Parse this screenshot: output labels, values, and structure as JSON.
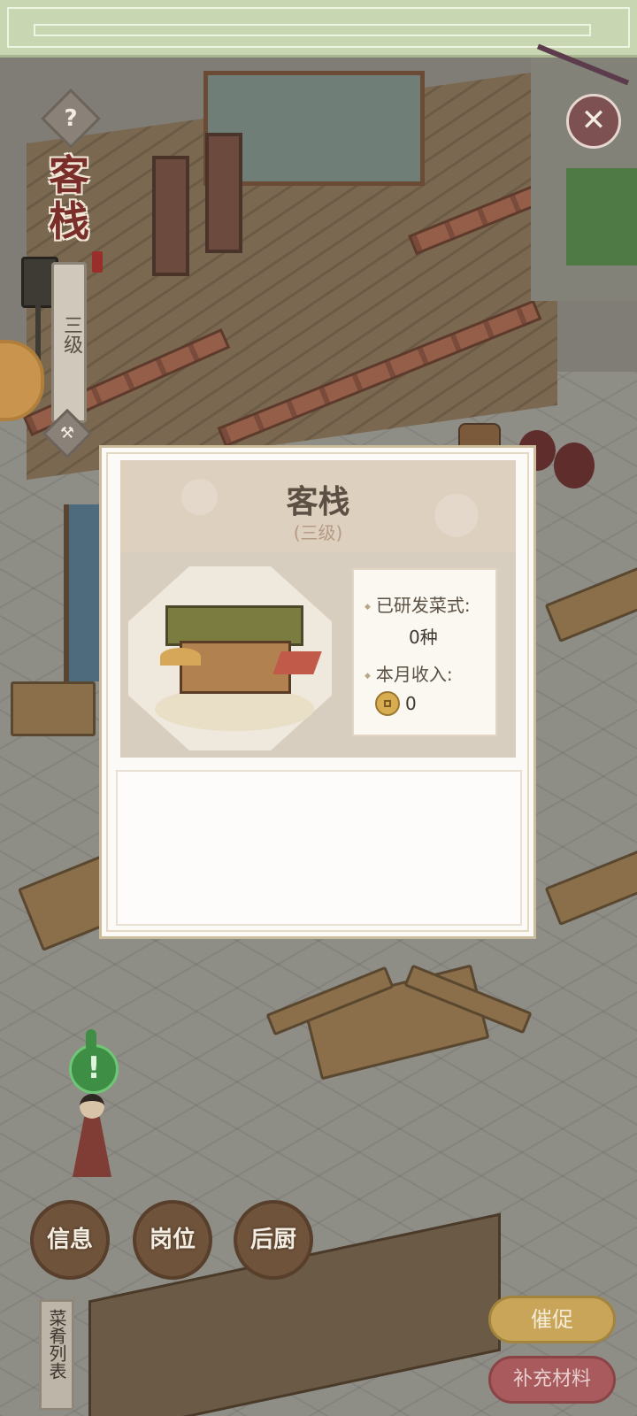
{
  "header": {
    "building_name": "客栈",
    "level": "三级"
  },
  "popup": {
    "title": "客栈",
    "subtitle": "(三级)",
    "stats": {
      "dishes_label": "已研发菜式:",
      "dishes_value": "0种",
      "income_label": "本月收入:",
      "income_value": "0"
    },
    "description": ""
  },
  "buttons": {
    "help_icon": "?",
    "close_icon": "✕",
    "info": "信息",
    "positions": "岗位",
    "kitchen": "后厨",
    "menu_list": "菜肴列表",
    "urge": "催促",
    "supply": "补充材料"
  },
  "npc": {
    "alert": "!"
  },
  "icons": {
    "help": "help-icon",
    "close": "close-icon",
    "hammer": "hammer-icon",
    "coin": "coin-icon",
    "alert": "exclamation-icon"
  },
  "colors": {
    "title_red": "#7a2e2a",
    "modal_bg": "#fbfaf6",
    "urge_gold": "#c9a55a",
    "supply_red": "#a85a5c"
  }
}
